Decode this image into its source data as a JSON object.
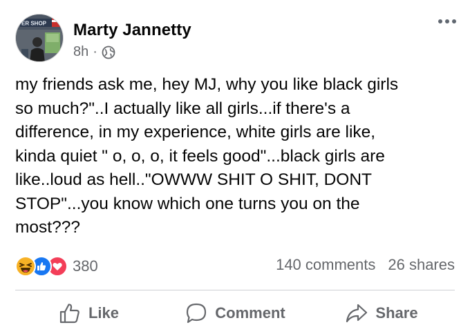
{
  "post": {
    "author": "Marty Jannetty",
    "time": "8h",
    "separator": "·",
    "avatar_sign_text": "ER SHOP",
    "body": "my friends ask me, hey MJ, why you like black girls\nso much?\"..I actually like all girls...if there's a\ndifference, in my experience, white girls are like,\nkinda quiet \" o, o, o, it feels good\"...black girls are\nlike..loud as hell..\"OWWW SHIT O SHIT, DONT\nSTOP\"...you know which one turns you on the\nmost???"
  },
  "engagement": {
    "reaction_icons": [
      "haha-reaction-icon",
      "like-reaction-icon",
      "love-reaction-icon"
    ],
    "reaction_count": "380",
    "comments": "140 comments",
    "shares": "26 shares"
  },
  "actions": {
    "like_label": "Like",
    "comment_label": "Comment",
    "share_label": "Share"
  },
  "colors": {
    "text": "#050505",
    "secondary": "#65676b",
    "like_blue": "#1877f2",
    "love_red": "#f33e58",
    "haha_yellow": "#f7b125",
    "divider": "#ced0d4"
  }
}
